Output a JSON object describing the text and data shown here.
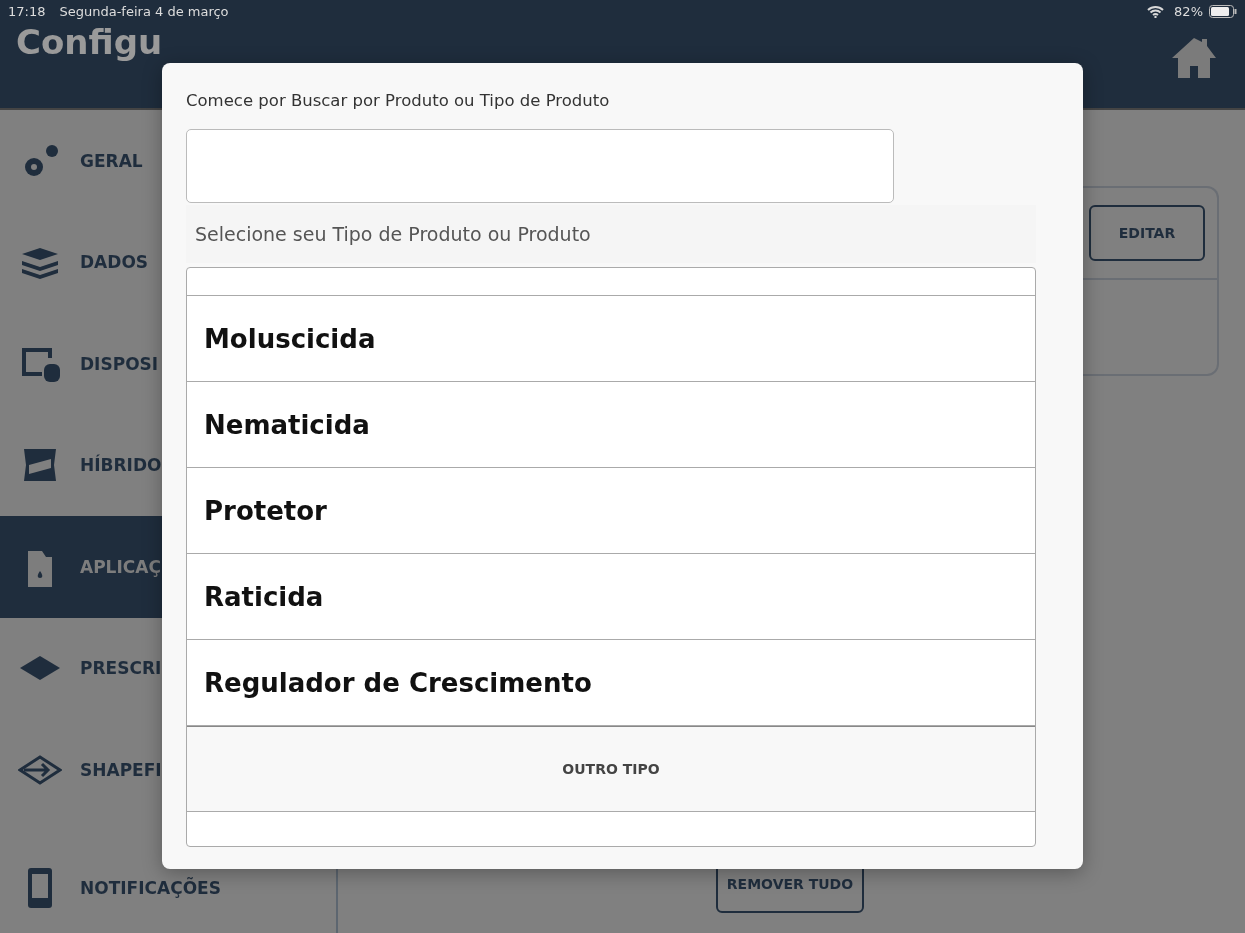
{
  "status_bar": {
    "time": "17:18",
    "date": "Segunda-feira 4 de março",
    "battery": "82%"
  },
  "header": {
    "title": "Configu"
  },
  "sidebar": {
    "items": [
      {
        "label": "GERAL",
        "selected": false
      },
      {
        "label": "DADOS",
        "selected": false
      },
      {
        "label": "DISPOSI",
        "selected": false
      },
      {
        "label": "HÍBRIDO",
        "selected": false
      },
      {
        "label": "APLICAÇ",
        "selected": true
      },
      {
        "label": "PRESCRI",
        "selected": false
      },
      {
        "label": "SHAPEFI",
        "selected": false
      },
      {
        "label": "NOTIFICAÇÕES",
        "selected": false
      }
    ]
  },
  "background": {
    "edit_button": "EDITAR",
    "remove_all_button": "REMOVER TUDO"
  },
  "dialog": {
    "search_label": "Comece por Buscar por Produto ou Tipo de Produto",
    "list_heading": "Selecione seu Tipo de Produto ou Produto",
    "items": [
      {
        "label": "Moluscicida"
      },
      {
        "label": "Nematicida"
      },
      {
        "label": "Protetor"
      },
      {
        "label": "Raticida"
      },
      {
        "label": "Regulador de Crescimento"
      }
    ],
    "other_button": "OUTRO TIPO"
  }
}
